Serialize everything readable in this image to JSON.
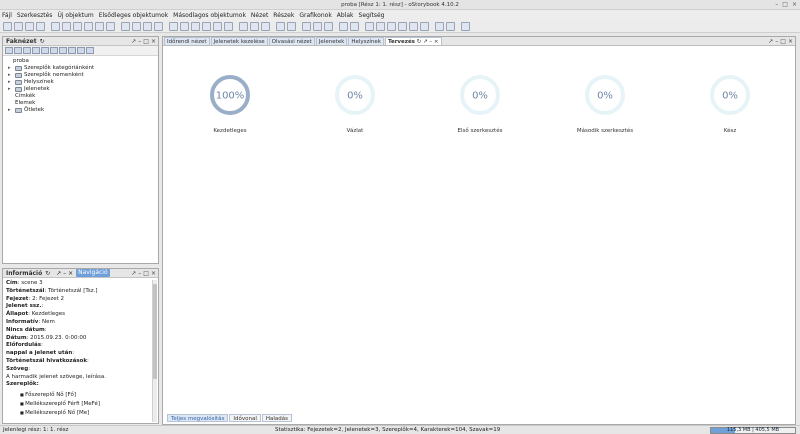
{
  "window": {
    "title": "proba [Rész 1: 1. rész] - oStorybook 4.10.2"
  },
  "menu": [
    "Fájl",
    "Szerkesztés",
    "Új objektum",
    "Elsődleges objektumok",
    "Másodlagos objektumok",
    "Nézet",
    "Részek",
    "Grafikonok",
    "Ablak",
    "Segítség"
  ],
  "tree_panel": {
    "title": "Faknézet",
    "items": [
      {
        "label": "proba",
        "level": 0,
        "expander": ""
      },
      {
        "label": "Szereplők kategóriánként",
        "level": 1,
        "expander": "▸"
      },
      {
        "label": "Szereplők nemenként",
        "level": 1,
        "expander": "▸"
      },
      {
        "label": "Helyszínek",
        "level": 1,
        "expander": "▸"
      },
      {
        "label": "Jelenetek",
        "level": 1,
        "expander": "▸"
      },
      {
        "label": "Címkék",
        "level": 1,
        "expander": ""
      },
      {
        "label": "Elemek",
        "level": 1,
        "expander": ""
      },
      {
        "label": "Ötletek",
        "level": 1,
        "expander": "▸"
      }
    ]
  },
  "info_panel": {
    "title": "Információ",
    "tab_nav": "Navigáció",
    "fields": [
      {
        "k": "Cím",
        "v": "scene 3"
      },
      {
        "k": "Történetszál",
        "v": "Történetszál [Tsz.]"
      },
      {
        "k": "Fejezet",
        "v": "2: Fejezet 2"
      },
      {
        "k": "Jelenet ssz.",
        "v": ""
      },
      {
        "k": "Állapot",
        "v": "Kezdetleges"
      },
      {
        "k": "Informatív",
        "v": "Nem"
      },
      {
        "k": "Nincs dátum",
        "v": ""
      },
      {
        "k": "Dátum",
        "v": "2015.09.23. 0:00:00"
      },
      {
        "k": "Előfordulás",
        "v": ""
      },
      {
        "k": "nappal a jelenet után",
        "v": ""
      },
      {
        "k": "Történetszál hivatkozások",
        "v": ""
      },
      {
        "k": "Szöveg",
        "v": ""
      }
    ],
    "text": "A harmadik jelenet szövege, leírása.",
    "actors_label": "Szereplők:",
    "actors": [
      "Főszereplő Nő [Fő]",
      "Mellékszereplő Férfi [MeFé]",
      "Mellékszereplő Nő [Me]"
    ]
  },
  "main": {
    "tabs": [
      "Időrendi nézet",
      "Jelenetek kezelése",
      "Olvasási nézet",
      "Jelenetek",
      "Helyszínek",
      "Tervezés"
    ],
    "active_tab": 5,
    "rings": [
      {
        "label": "Kezdetleges",
        "text": "100%",
        "fraction": 1.0
      },
      {
        "label": "Vázlat",
        "text": "0%",
        "fraction": 0
      },
      {
        "label": "Első szerkesztés",
        "text": "0%",
        "fraction": 0
      },
      {
        "label": "Második szerkesztés",
        "text": "0%",
        "fraction": 0
      },
      {
        "label": "Kész",
        "text": "0%",
        "fraction": 0
      }
    ],
    "bottom_tabs": [
      "Teljes megvalósítás",
      "Idővonal",
      "Haladás"
    ],
    "colors": {
      "full_ring": "#9aaec8",
      "empty_ring": "#e6f4f8",
      "ring_text": "#6f86a6"
    }
  },
  "status": {
    "left": "Jelenlegi rész: 1: 1. rész",
    "stats": "Statisztika: Fejezetek=2, Jelenetek=3, Szereplők=4, Karakterek=104, Szavak=19",
    "memory": "115,3 MB | 405,5 MB",
    "memory_fraction": 0.28
  }
}
